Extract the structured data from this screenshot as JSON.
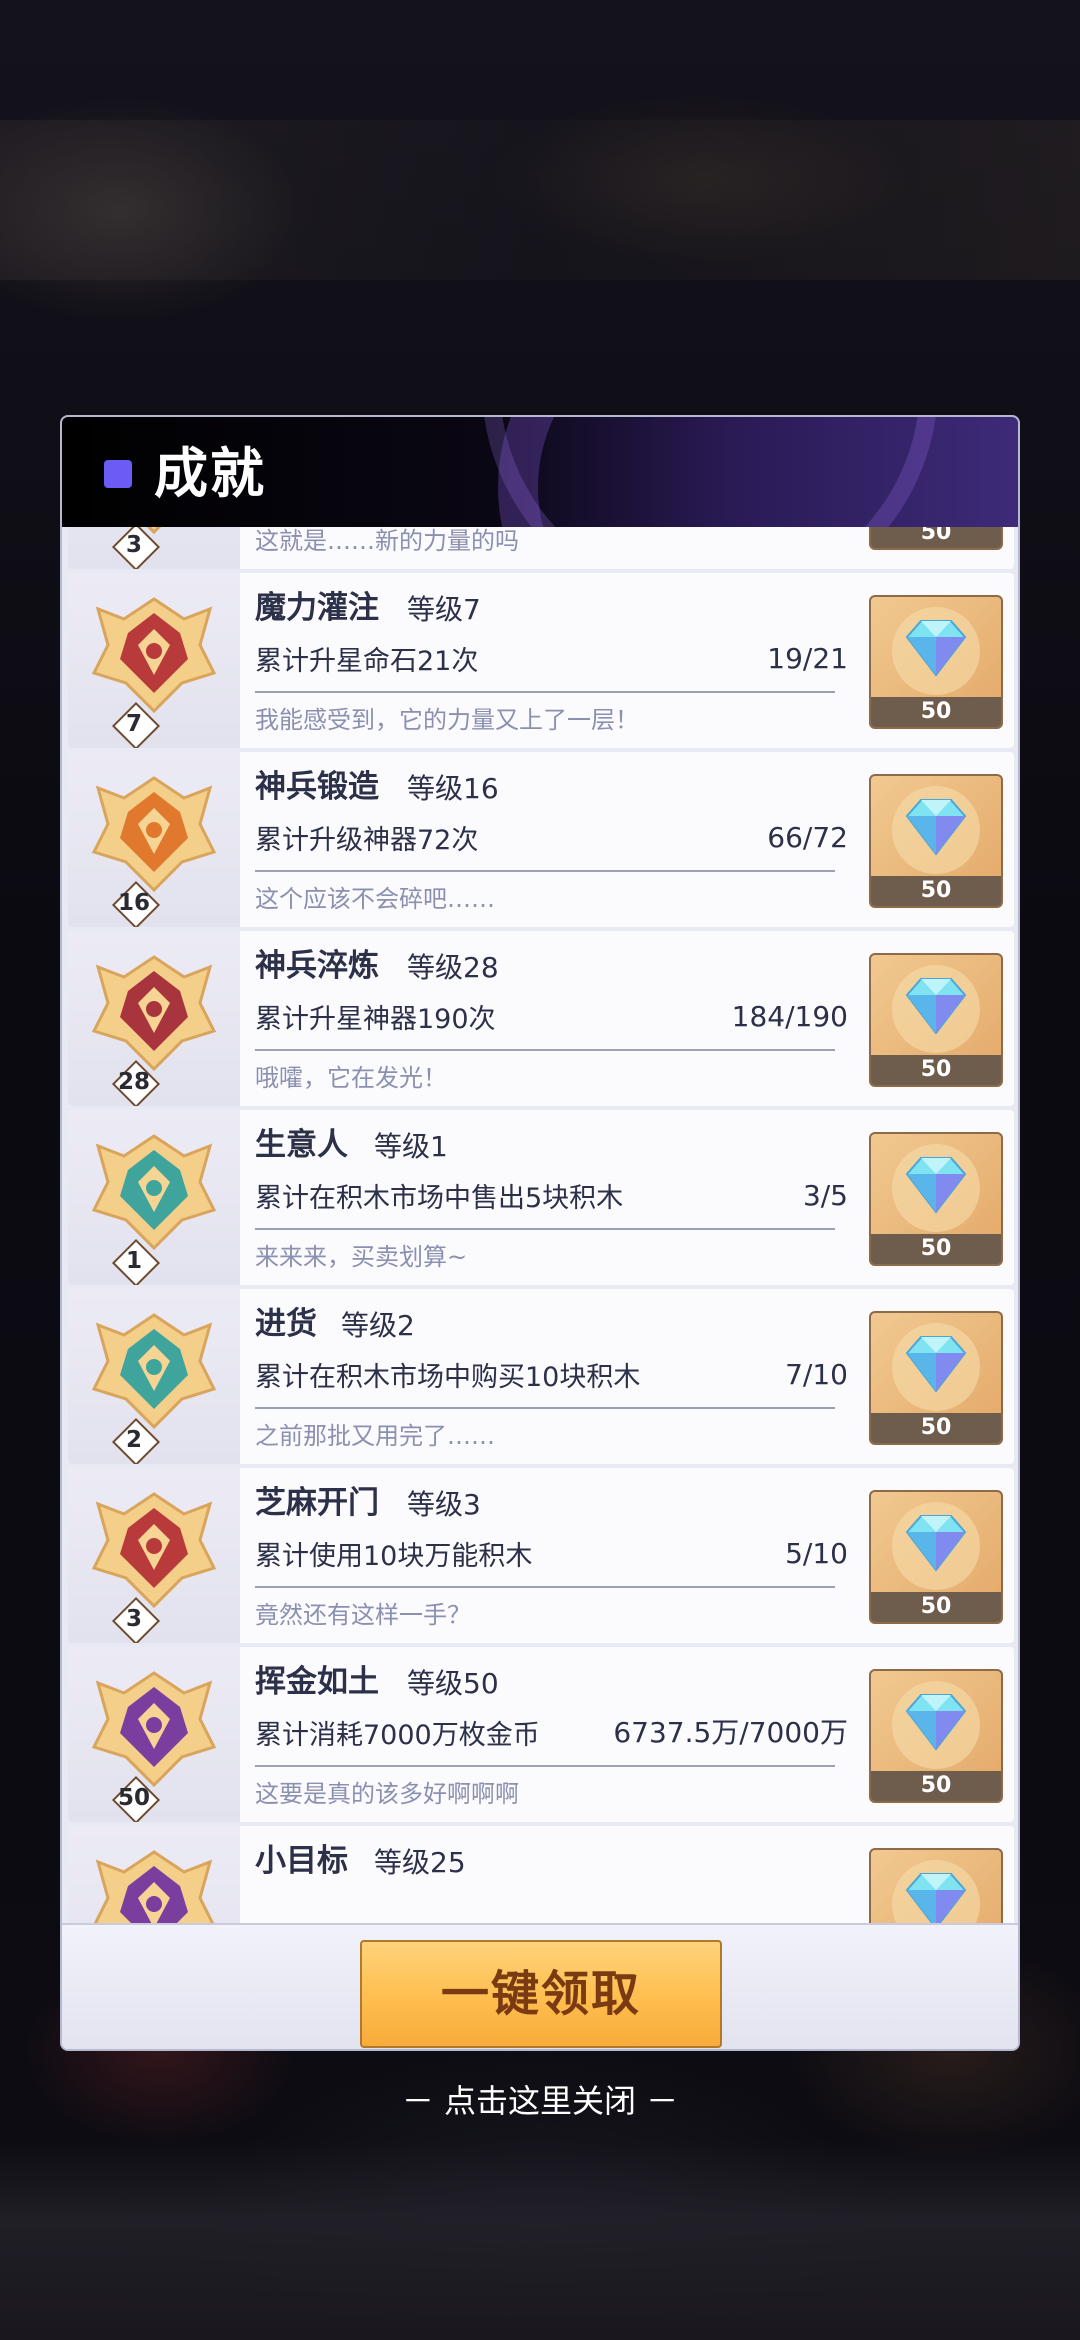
{
  "dialog": {
    "title": "成就",
    "claim_all_label": "一键领取",
    "close_hint": "－ 点击这里关闭 －"
  },
  "achievements": [
    {
      "name": "",
      "level_text": "",
      "level": "3",
      "desc": "",
      "progress": "",
      "flavor": "这就是……新的力量的吗",
      "reward": "50",
      "theme": "red"
    },
    {
      "name": "魔力灌注",
      "level_text": "等级7",
      "level": "7",
      "desc": "累计升星命石21次",
      "progress": "19/21",
      "flavor": "我能感受到，它的力量又上了一层！",
      "reward": "50",
      "theme": "red"
    },
    {
      "name": "神兵锻造",
      "level_text": "等级16",
      "level": "16",
      "desc": "累计升级神器72次",
      "progress": "66/72",
      "flavor": "这个应该不会碎吧……",
      "reward": "50",
      "theme": "orange"
    },
    {
      "name": "神兵淬炼",
      "level_text": "等级28",
      "level": "28",
      "desc": "累计升星神器190次",
      "progress": "184/190",
      "flavor": "哦嚯，它在发光！",
      "reward": "50",
      "theme": "crimson"
    },
    {
      "name": "生意人",
      "level_text": "等级1",
      "level": "1",
      "desc": "累计在积木市场中售出5块积木",
      "progress": "3/5",
      "flavor": "来来来，买卖划算~",
      "reward": "50",
      "theme": "teal"
    },
    {
      "name": "进货",
      "level_text": "等级2",
      "level": "2",
      "desc": "累计在积木市场中购买10块积木",
      "progress": "7/10",
      "flavor": "之前那批又用完了……",
      "reward": "50",
      "theme": "teal"
    },
    {
      "name": "芝麻开门",
      "level_text": "等级3",
      "level": "3",
      "desc": "累计使用10块万能积木",
      "progress": "5/10",
      "flavor": "竟然还有这样一手？",
      "reward": "50",
      "theme": "red"
    },
    {
      "name": "挥金如土",
      "level_text": "等级50",
      "level": "50",
      "desc": "累计消耗7000万枚金币",
      "progress": "6737.5万/7000万",
      "flavor": "这要是真的该多好啊啊啊",
      "reward": "50",
      "theme": "purple"
    },
    {
      "name": "小目标",
      "level_text": "等级25",
      "level": "",
      "desc": "",
      "progress": "",
      "flavor": "",
      "reward": "",
      "theme": "purple"
    }
  ],
  "colors": {
    "red": "#b83a3a",
    "orange": "#e0792e",
    "crimson": "#a8343e",
    "teal": "#3fa59c",
    "purple": "#7a3f9e",
    "gold": "#f2c36b",
    "accent": "#6a5cf5"
  },
  "icons": {
    "badge": "achievement-badge-icon",
    "gem": "diamond-gem-icon"
  }
}
